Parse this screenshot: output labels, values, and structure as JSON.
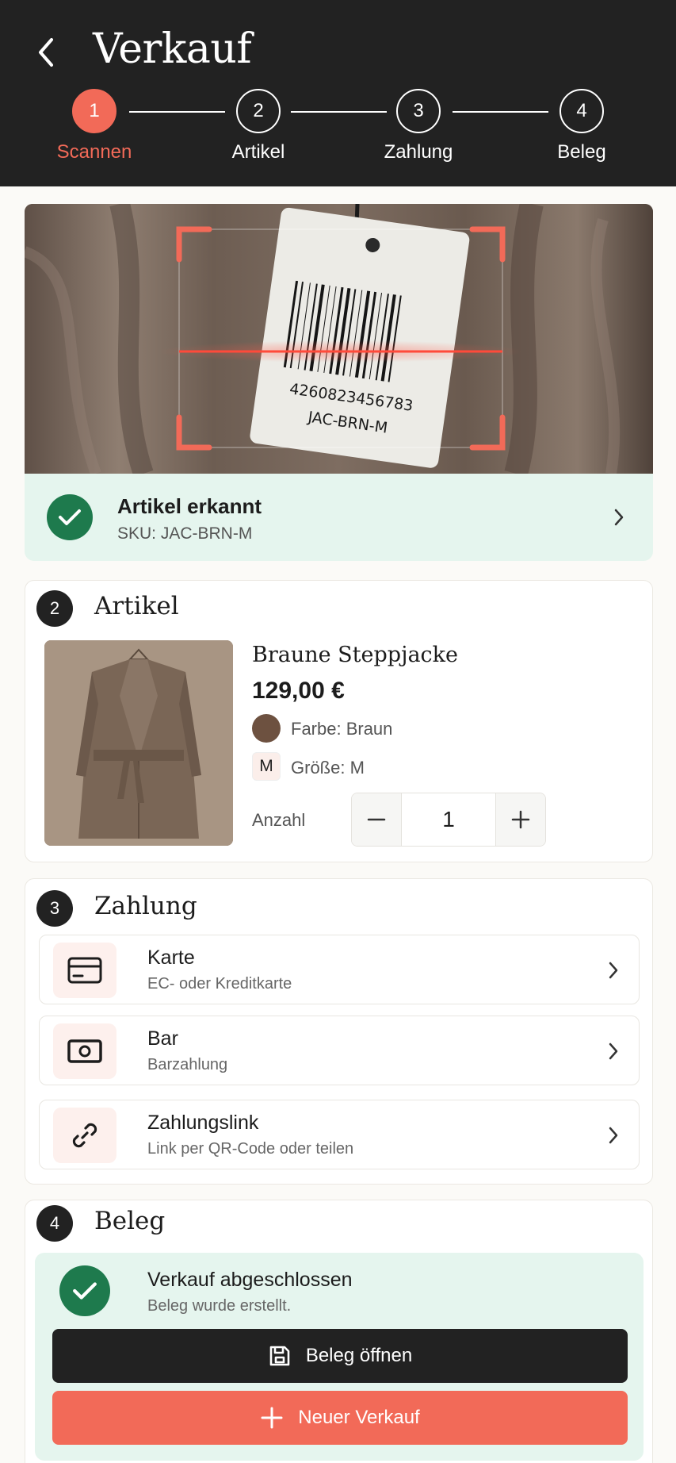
{
  "header": {
    "title": "Verkauf",
    "steps": [
      {
        "num": "1",
        "label": "Scannen",
        "active": true
      },
      {
        "num": "2",
        "label": "Artikel"
      },
      {
        "num": "3",
        "label": "Zahlung"
      },
      {
        "num": "4",
        "label": "Beleg"
      }
    ]
  },
  "scan": {
    "barcode_number": "4260823456783",
    "tag_sku": "JAC-BRN-M",
    "result_title": "Artikel erkannt",
    "result_sku": "SKU: JAC-BRN-M"
  },
  "article": {
    "badge": "2",
    "title": "Artikel",
    "name": "Braune Steppjacke",
    "price": "129,00 €",
    "color_label": "Farbe: Braun",
    "size_chip": "M",
    "size_label": "Größe: M",
    "quantity_label": "Anzahl",
    "quantity": "1"
  },
  "payment": {
    "badge": "3",
    "title": "Zahlung",
    "options": [
      {
        "title": "Karte",
        "subtitle": "EC- oder Kreditkarte",
        "icon": "credit-card-icon"
      },
      {
        "title": "Bar",
        "subtitle": "Barzahlung",
        "icon": "cash-icon"
      },
      {
        "title": "Zahlungslink",
        "subtitle": "Link per QR-Code oder teilen",
        "icon": "link-icon"
      }
    ]
  },
  "receipt": {
    "badge": "4",
    "title": "Beleg",
    "done_title": "Verkauf abgeschlossen",
    "done_subtitle": "Beleg wurde erstellt.",
    "open_button": "Beleg öffnen",
    "new_button": "Neuer Verkauf"
  },
  "colors": {
    "accent": "#f26a58",
    "header_bg": "#222222",
    "success": "#1e7a4d",
    "success_bg": "#e5f5ee"
  }
}
